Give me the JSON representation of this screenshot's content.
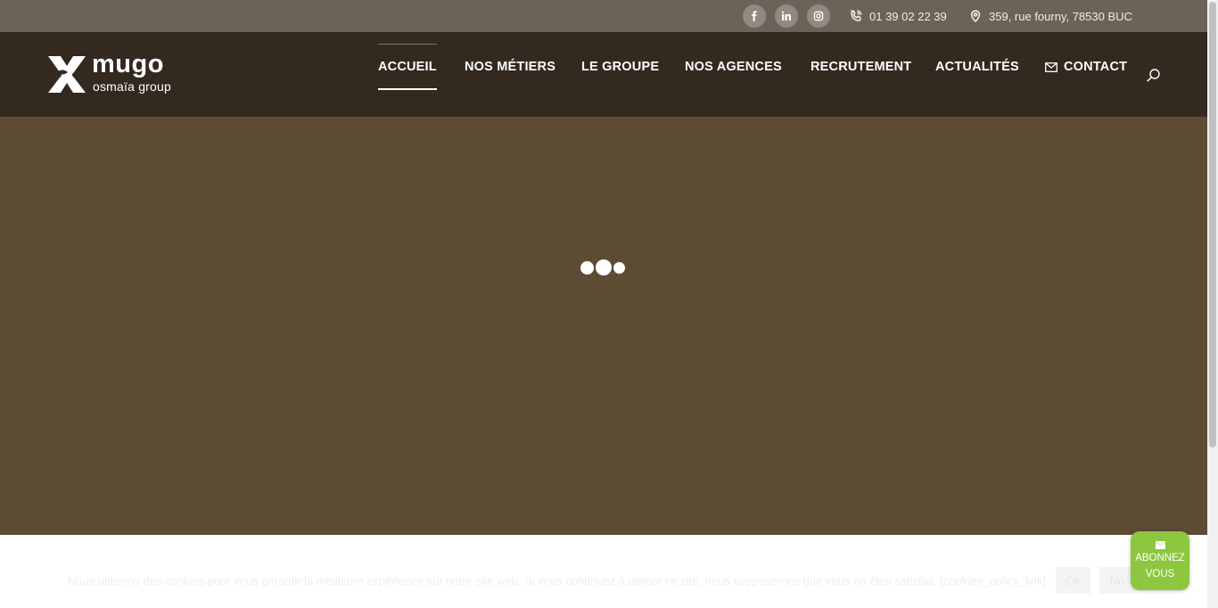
{
  "topbar": {
    "social": [
      {
        "icon": "facebook-icon"
      },
      {
        "icon": "linkedin-icon"
      },
      {
        "icon": "instagram-icon"
      }
    ],
    "phone": "01 39 02 22 39",
    "address": "359, rue fourny, 78530 BUC"
  },
  "logo": {
    "name": "mugo",
    "subtitle": "osmaïa group"
  },
  "nav": {
    "items": [
      {
        "label": "ACCUEIL",
        "active": true
      },
      {
        "label": "NOS MÉTIERS"
      },
      {
        "label": "LE GROUPE"
      },
      {
        "label": "NOS AGENCES"
      },
      {
        "label": "RECRUTEMENT"
      },
      {
        "label": "ACTUALITÉS"
      },
      {
        "label": "CONTACT",
        "icon": "mail-icon"
      }
    ],
    "search_icon": "search-icon"
  },
  "hero": {
    "state": "loading",
    "background": "#5e4b34"
  },
  "cookie": {
    "text": "Nous utilisons des cookies pour vous garantir la meilleure expérience sur notre site web. Si vous continuez à utiliser ce site, nous supposerons que vous en êtes satisfait. [cookies_policy_link]",
    "ok_label": "Ok",
    "no_label": "No"
  },
  "subscribe": {
    "line1": "ABONNEZ",
    "line2": "VOUS",
    "icon": "envelope-icon",
    "color": "#8dc63f"
  },
  "colors": {
    "topbar": "#6b6258",
    "header": "#33291f",
    "hero": "#5e4b34"
  }
}
